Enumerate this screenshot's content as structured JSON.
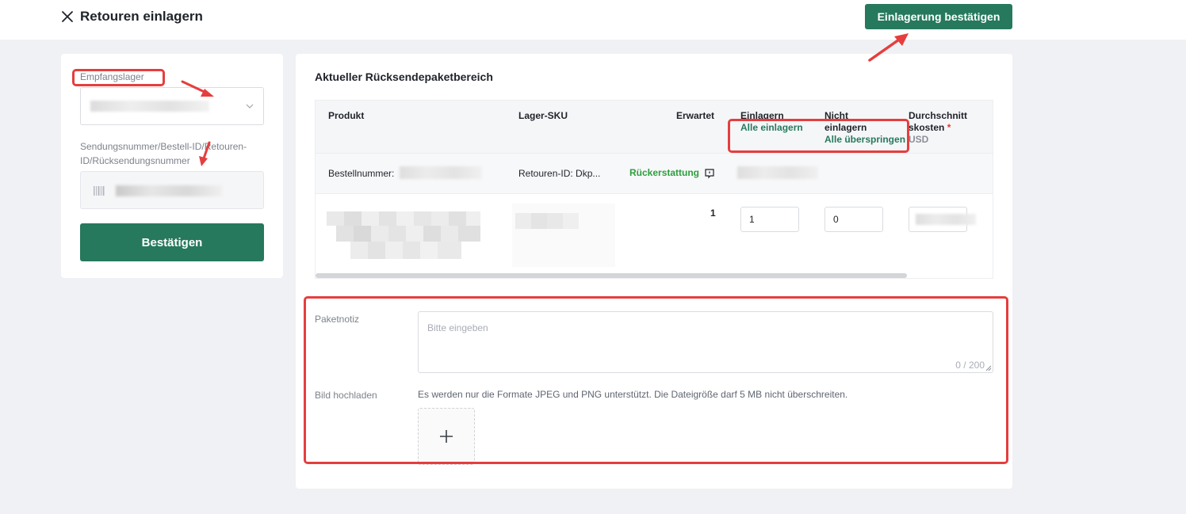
{
  "header": {
    "title": "Retouren einlagern",
    "confirm_top_label": "Einlagerung bestätigen"
  },
  "left_panel": {
    "warehouse_label": "Empfangslager",
    "tracking_label": "Sendungsnummer/Bestell-ID/Retouren-ID/Rücksendungsnummer",
    "confirm_label": "Bestätigen"
  },
  "main": {
    "section_title": "Aktueller Rücksendepaketbereich",
    "table": {
      "headers": {
        "product": "Produkt",
        "sku": "Lager-SKU",
        "expected": "Erwartet",
        "store_in": "Einlagern",
        "store_all": "Alle einlagern",
        "not_store_1": "Nicht",
        "not_store_2": "einlagern",
        "skip_all": "Alle überspringen",
        "avg_cost_1": "Durchschnitt",
        "avg_cost_2": "skosten",
        "avg_cost_required": "*",
        "currency": "USD"
      },
      "group_row": {
        "order_label": "Bestellnummer:",
        "return_label": "Retouren-ID: Dkp...",
        "status": "Rückerstattung"
      },
      "row": {
        "expected": "1",
        "store_in_value": "1",
        "not_store_value": "0"
      }
    },
    "form": {
      "note_label": "Paketnotiz",
      "note_placeholder": "Bitte eingeben",
      "note_counter": "0 / 200",
      "upload_label": "Bild hochladen",
      "upload_hint": "Es werden nur die Formate JPEG und PNG unterstützt. Die Dateigröße darf 5 MB nicht überschreiten."
    }
  },
  "icons": {
    "close": "close-icon",
    "chevron": "chevron-down-icon",
    "barcode": "barcode-scan-icon",
    "note": "comment-icon",
    "plus": "plus-icon"
  },
  "colors": {
    "primary": "#26795c",
    "refund_status": "#2e9d3c",
    "annotation": "#e53e3e"
  }
}
